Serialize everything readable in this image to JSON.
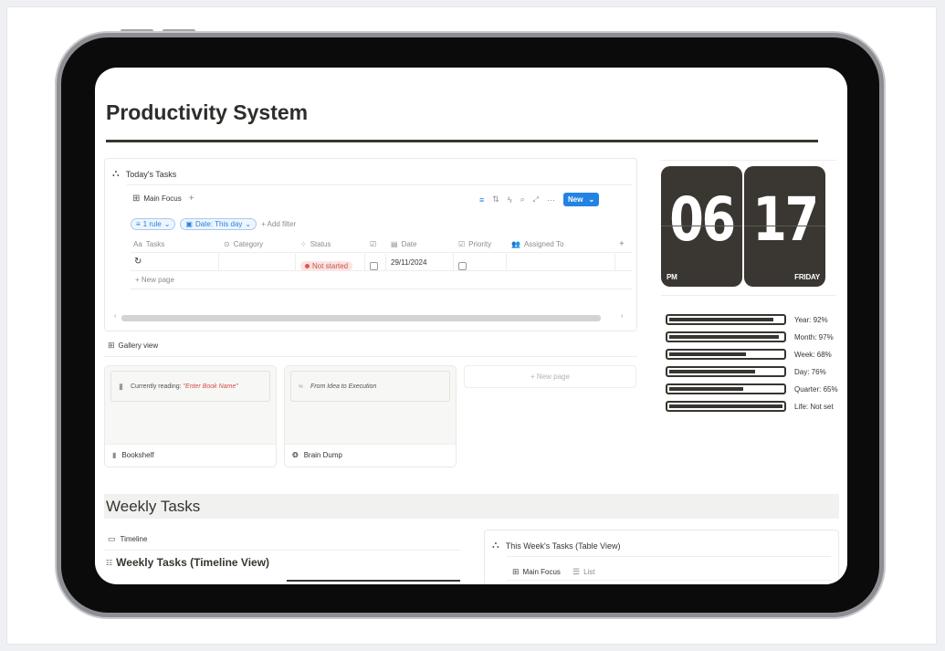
{
  "page": {
    "title": "Productivity System"
  },
  "todays_tasks": {
    "heading": "Today's Tasks",
    "view_tab": "Main Focus",
    "new_label": "New",
    "filters": {
      "rule_pill": "1 rule",
      "date_pill": "Date: This day",
      "add_filter": "+ Add filter"
    },
    "columns": [
      "Tasks",
      "Category",
      "Status",
      "",
      "Date",
      "Priority",
      "Assigned To"
    ],
    "rows": [
      {
        "task": "",
        "category": "",
        "status": "Not started",
        "date": "29/11/2024"
      }
    ],
    "new_page": "+ New page"
  },
  "clock": {
    "hours": "06",
    "minutes": "17",
    "meridiem": "PM",
    "day": "FRIDAY"
  },
  "progress": [
    {
      "label": "Year: 92%",
      "value": 92
    },
    {
      "label": "Month: 97%",
      "value": 97
    },
    {
      "label": "Week: 68%",
      "value": 68
    },
    {
      "label": "Day: 76%",
      "value": 76
    },
    {
      "label": "Quarter: 65%",
      "value": 65
    },
    {
      "label": "Life: Not set",
      "value": 100
    }
  ],
  "gallery": {
    "heading": "Gallery view",
    "cards": [
      {
        "preview_prefix": "Currently reading: ",
        "preview_highlight": "\"Enter Book Name\"",
        "name": "Bookshelf"
      },
      {
        "preview_prefix": "From Idea to Execution",
        "preview_highlight": "",
        "name": "Brain Dump"
      }
    ],
    "new_page": "+ New page"
  },
  "weekly": {
    "heading": "Weekly Tasks",
    "timeline_tab": "Timeline",
    "timeline_title": "Weekly Tasks (Timeline View)",
    "table_heading": "This Week's Tasks (Table View)",
    "table_tabs": [
      "Main Focus",
      "List"
    ]
  },
  "colors": {
    "accent": "#2383e2",
    "clock_bg": "#3a3733",
    "status_red": "#e0574c"
  }
}
